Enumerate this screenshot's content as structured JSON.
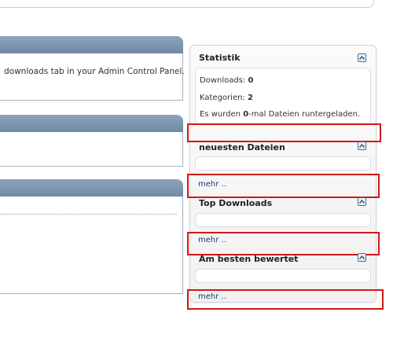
{
  "left": {
    "panel1_text": "downloads tab in your Admin Control Panel."
  },
  "sidebar": {
    "statistik": {
      "title": "Statistik",
      "downloads_label": "Downloads: ",
      "downloads_value": "0",
      "kategorien_label": "Kategorien: ",
      "kategorien_value": "2",
      "summary_prefix": "Es wurden ",
      "summary_value": "0",
      "summary_suffix": "-mal Dateien runtergeladen."
    },
    "neueste": {
      "title": "neuesten Dateien",
      "more": "mehr .."
    },
    "top": {
      "title": "Top Downloads",
      "more": "mehr .."
    },
    "best": {
      "title": "Am besten bewertet",
      "more": "mehr .."
    }
  },
  "colors": {
    "panel_header": "#7d97b0",
    "highlight": "#d01818",
    "link": "#1a3d6a"
  },
  "icons": [
    "collapse-up-icon"
  ]
}
